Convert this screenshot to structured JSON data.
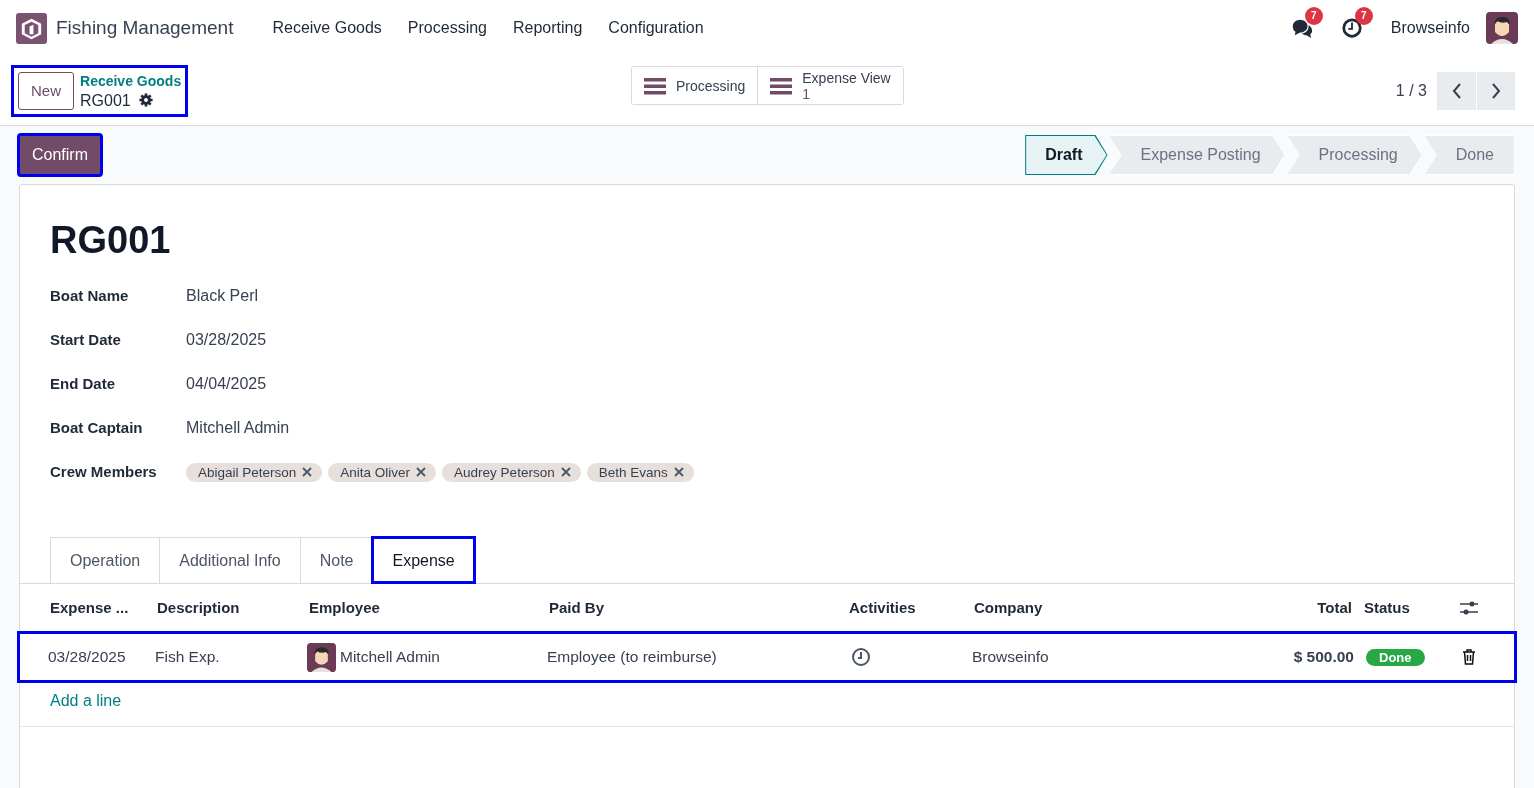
{
  "navbar": {
    "app_name": "Fishing Management",
    "menu": [
      "Receive Goods",
      "Processing",
      "Reporting",
      "Configuration"
    ],
    "messages_count": "7",
    "activities_count": "7",
    "company": "Browseinfo"
  },
  "control_panel": {
    "new_button": "New",
    "breadcrumb": "Receive Goods",
    "record": "RG001",
    "highlighted": true,
    "smart_buttons": [
      {
        "label": "Processing"
      },
      {
        "label": "Expense View",
        "count": "1"
      }
    ],
    "pager": "1 / 3"
  },
  "status_bar": {
    "confirm_button": "Confirm",
    "confirm_highlighted": true,
    "stages": [
      {
        "label": "Draft",
        "selected": true
      },
      {
        "label": "Expense Posting",
        "selected": false
      },
      {
        "label": "Processing",
        "selected": false
      },
      {
        "label": "Done",
        "selected": false
      }
    ]
  },
  "form": {
    "title": "RG001",
    "fields": [
      {
        "kind": "text",
        "label": "Boat Name",
        "value": "Black Perl"
      },
      {
        "kind": "text",
        "label": "Start Date",
        "value": "03/28/2025"
      },
      {
        "kind": "text",
        "label": "End Date",
        "value": "04/04/2025"
      },
      {
        "kind": "text",
        "label": "Boat Captain",
        "value": "Mitchell Admin"
      },
      {
        "kind": "tags",
        "label": "Crew Members",
        "tags": [
          "Abigail Peterson",
          "Anita Oliver",
          "Audrey Peterson",
          "Beth Evans"
        ]
      }
    ],
    "tabs": [
      {
        "label": "Operation",
        "selected": false,
        "highlighted": false
      },
      {
        "label": "Additional Info",
        "selected": false,
        "highlighted": false
      },
      {
        "label": "Note",
        "selected": false,
        "highlighted": false
      },
      {
        "label": "Expense",
        "selected": true,
        "highlighted": true
      }
    ],
    "table": {
      "columns": [
        "Expense ...",
        "Description",
        "Employee",
        "Paid By",
        "Activities",
        "Company",
        "Total",
        "Status"
      ],
      "rows": [
        {
          "date": "03/28/2025",
          "description": "Fish Exp.",
          "employee": "Mitchell Admin",
          "paid_by": "Employee (to reimburse)",
          "company": "Browseinfo",
          "total": "$ 500.00",
          "status": "Done",
          "highlighted": true
        }
      ],
      "add_line": "Add a line"
    }
  }
}
